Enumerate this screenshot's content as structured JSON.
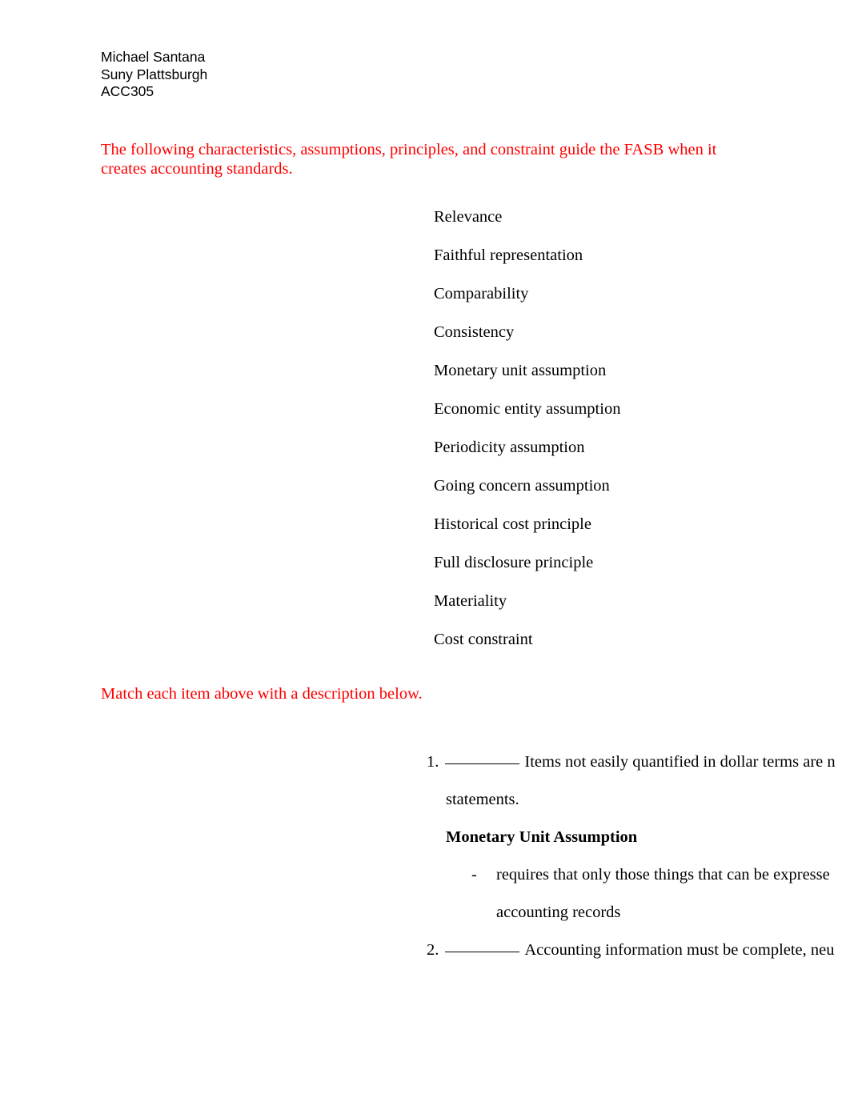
{
  "header": {
    "student_name": "Michael Santana",
    "school": "Suny Plattsburgh",
    "course": "ACC305"
  },
  "intro": {
    "text": "The following characteristics, assumptions, principles, and constraint guide the FASB when it creates accounting standards.",
    "color": "#ff0000"
  },
  "terms": [
    {
      "label": "Relevance"
    },
    {
      "label": "Faithful representation"
    },
    {
      "label": "Comparability"
    },
    {
      "label": "Consistency"
    },
    {
      "label": "Monetary unit assumption"
    },
    {
      "label": "Economic entity assumption"
    },
    {
      "label": "Periodicity assumption"
    },
    {
      "label": "Going concern assumption"
    },
    {
      "label": "Historical cost principle"
    },
    {
      "label": "Full disclosure principle"
    },
    {
      "label": "Materiality"
    },
    {
      "label": "Cost constraint"
    }
  ],
  "match_instruction": {
    "text": "Match each item above with a description below.",
    "color": "#ff0000"
  },
  "answers": {
    "item1": {
      "number": "1.",
      "blank": "_________",
      "text": "Items not easily quantified in dollar terms are n",
      "continuation": "statements."
    },
    "answer1": {
      "heading": "Monetary Unit Assumption",
      "dash": "-",
      "bullet_text": "requires that only those things that can be expresse",
      "bullet_continuation": "accounting records"
    },
    "item2": {
      "number": "2.",
      "blank": "_________",
      "text": "Accounting information must be complete, neu"
    }
  }
}
